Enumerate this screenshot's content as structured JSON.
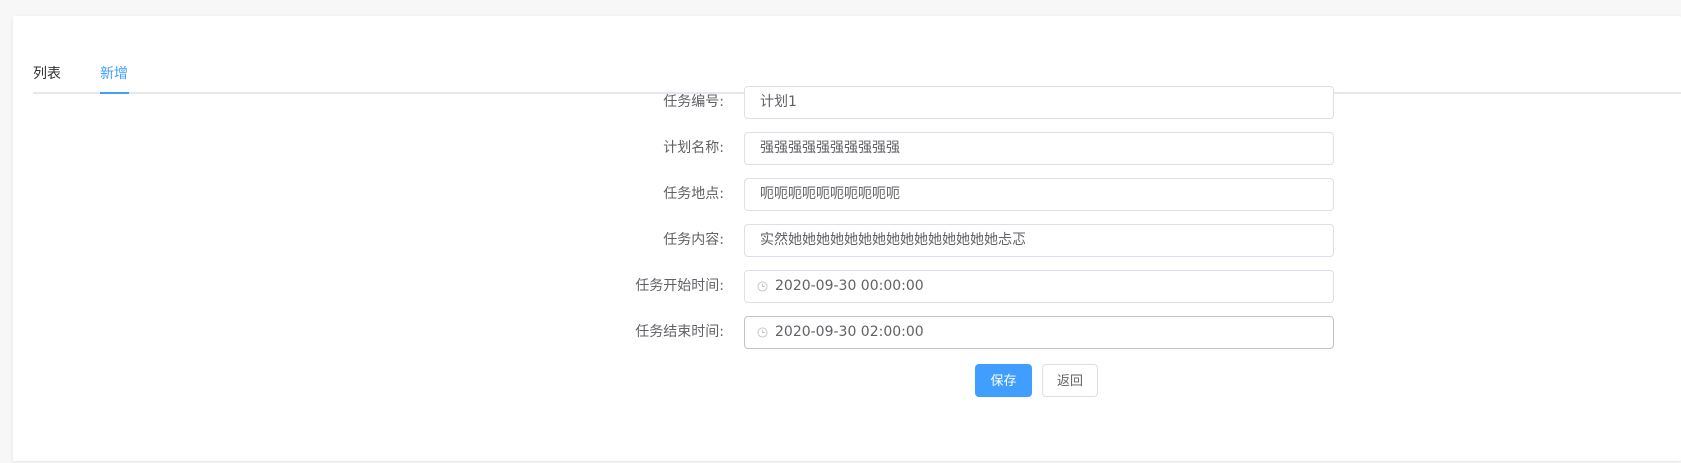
{
  "tabs": [
    {
      "label": "列表",
      "active": false
    },
    {
      "label": "新增",
      "active": true
    }
  ],
  "form": {
    "fields": [
      {
        "label": "任务编号:",
        "value": "计划1"
      },
      {
        "label": "计划名称:",
        "value": "强强强强强强强强强强"
      },
      {
        "label": "任务地点:",
        "value": "呃呃呃呃呃呃呃呃呃呃"
      },
      {
        "label": "任务内容:",
        "value": "实然她她她她她她她她她她她她她她她忐忑"
      },
      {
        "label": "任务开始时间:",
        "value": "2020-09-30 00:00:00",
        "icon": "clock-icon"
      },
      {
        "label": "任务结束时间:",
        "value": "2020-09-30 02:00:00",
        "icon": "clock-icon"
      }
    ],
    "save_label": "保存",
    "back_label": "返回"
  },
  "colors": {
    "primary": "#409eff",
    "border": "#dcdfe6",
    "text": "#606266"
  }
}
